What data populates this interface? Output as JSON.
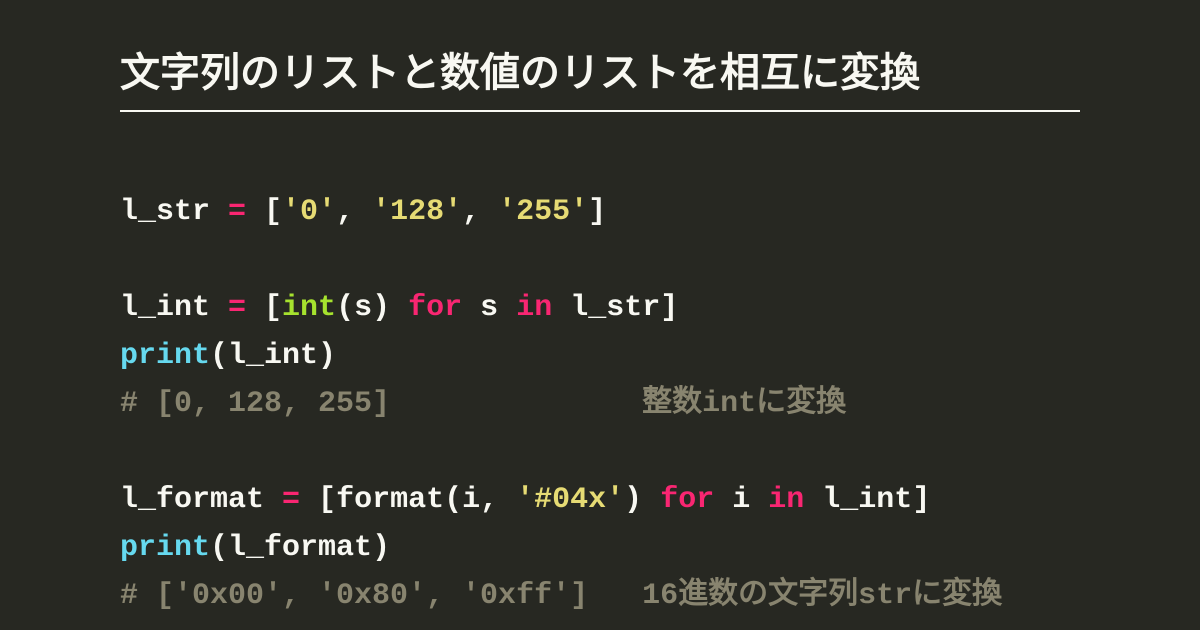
{
  "title": "文字列のリストと数値のリストを相互に変換",
  "code": {
    "line1": {
      "var": "l_str",
      "eq": " = ",
      "open": "[",
      "s0": "'0'",
      "c0": ", ",
      "s1": "'128'",
      "c1": ", ",
      "s2": "'255'",
      "close": "]"
    },
    "line3": {
      "var": "l_int",
      "eq": " = ",
      "open": "[",
      "int": "int",
      "lp": "(",
      "arg": "s",
      "rp": ")",
      "sp1": " ",
      "for": "for",
      "sp2": " ",
      "s": "s",
      "sp3": " ",
      "in": "in",
      "sp4": " ",
      "src": "l_str",
      "close": "]"
    },
    "line4": {
      "print": "print",
      "lp": "(",
      "arg": "l_int",
      "rp": ")"
    },
    "line5": {
      "comment": "# [0, 128, 255]              整数intに変換"
    },
    "line7": {
      "var": "l_format",
      "eq": " = ",
      "open": "[",
      "format": "format",
      "lp": "(",
      "i": "i",
      "c": ", ",
      "fmt": "'#04x'",
      "rp": ")",
      "sp1": " ",
      "for": "for",
      "sp2": " ",
      "ivar": "i",
      "sp3": " ",
      "in": "in",
      "sp4": " ",
      "src": "l_int",
      "close": "]"
    },
    "line8": {
      "print": "print",
      "lp": "(",
      "arg": "l_format",
      "rp": ")"
    },
    "line9": {
      "comment": "# ['0x00', '0x80', '0xff']   16進数の文字列strに変換"
    }
  }
}
